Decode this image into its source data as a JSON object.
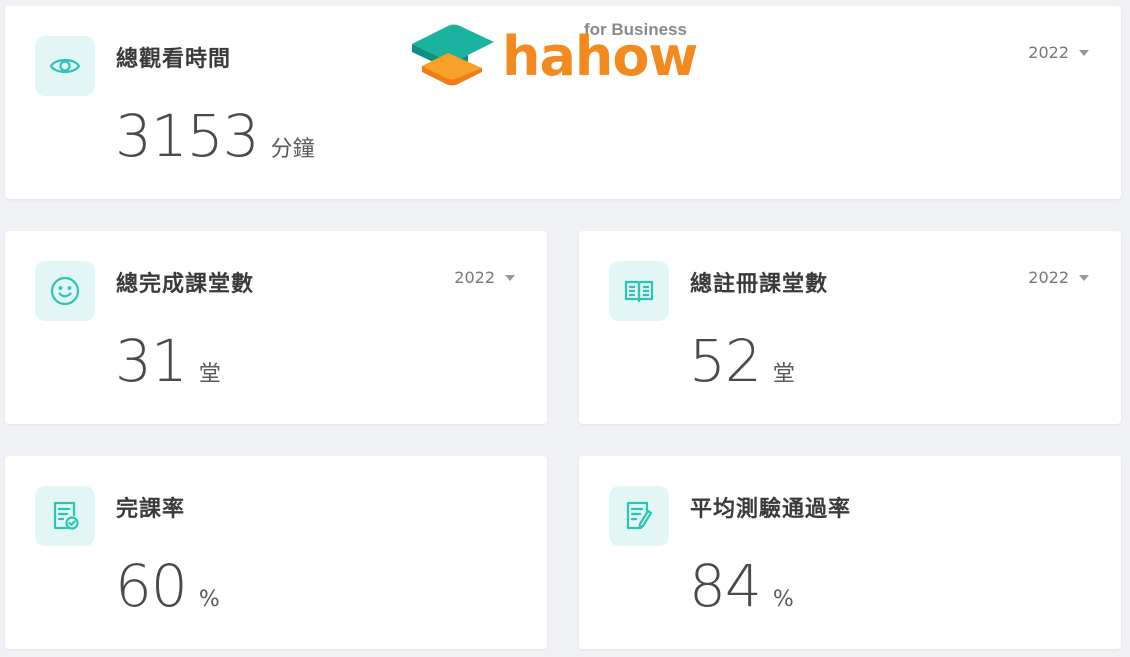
{
  "logo": {
    "brand": "hahow",
    "sub": "for Business"
  },
  "colors": {
    "accent": "#2bc5b4",
    "icon_bg": "#e2f7f5",
    "brand": "#f28a1f"
  },
  "cards": {
    "watch_time": {
      "title": "總觀看時間",
      "value": "3153",
      "unit": "分鐘",
      "year": "2022",
      "icon": "eye-icon"
    },
    "completed": {
      "title": "總完成課堂數",
      "value": "31",
      "unit": "堂",
      "year": "2022",
      "icon": "smile-icon"
    },
    "registered": {
      "title": "總註冊課堂數",
      "value": "52",
      "unit": "堂",
      "year": "2022",
      "icon": "book-icon"
    },
    "completion_rate": {
      "title": "完課率",
      "value": "60",
      "unit": "%",
      "icon": "document-check-icon"
    },
    "quiz_pass_rate": {
      "title": "平均測驗通過率",
      "value": "84",
      "unit": "%",
      "icon": "document-edit-icon"
    }
  }
}
